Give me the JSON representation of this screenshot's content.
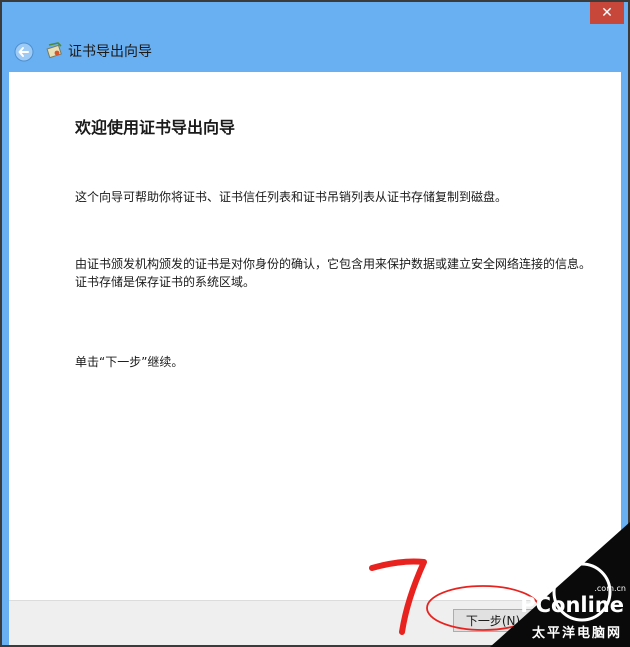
{
  "window": {
    "close_glyph": "✕",
    "close_color": "#c7483b"
  },
  "header": {
    "title": "证书导出向导",
    "back_icon": "back-arrow-icon",
    "wizard_icon": "certificate-icon"
  },
  "content": {
    "heading": "欢迎使用证书导出向导",
    "paragraphs": [
      "这个向导可帮助你将证书、证书信任列表和证书吊销列表从证书存储复制到磁盘。",
      "由证书颁发机构颁发的证书是对你身份的确认，它包含用来保护数据或建立安全网络连接的信息。证书存储是保存证书的系统区域。",
      "单击“下一步”继续。"
    ]
  },
  "footer": {
    "next_label": "下一步(N)"
  },
  "annotation": {
    "number": "7",
    "color": "#e8231f"
  },
  "watermark": {
    "brand": "PConline",
    "domain": ".com.cn",
    "subtitle": "太平洋电脑网"
  }
}
